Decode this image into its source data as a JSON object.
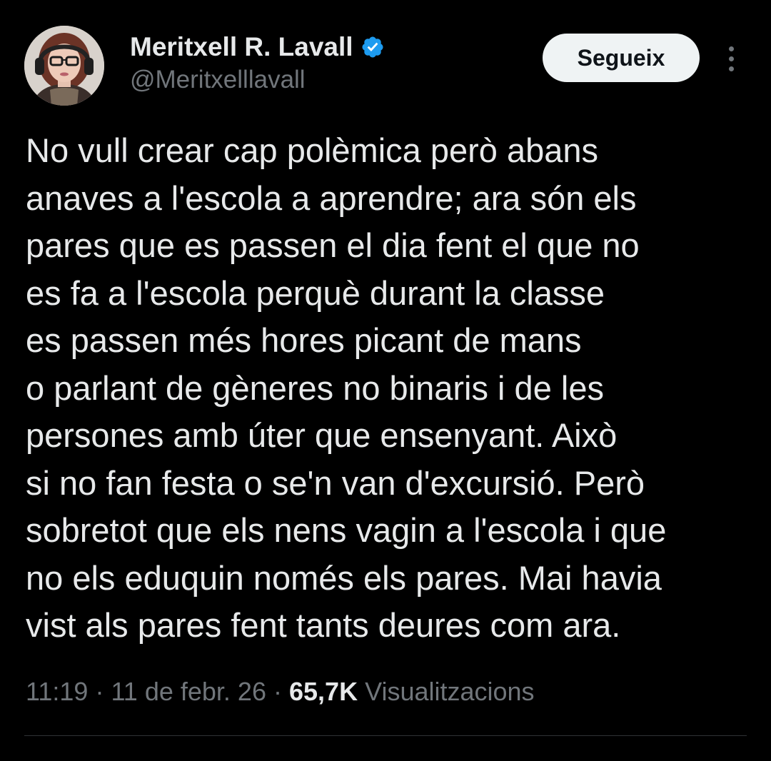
{
  "colors": {
    "background": "#000000",
    "text_primary": "#e7e9ea",
    "text_secondary": "#71767b",
    "verified_blue": "#1d9bf0",
    "follow_button_bg": "#eff3f4",
    "divider": "#2f3336"
  },
  "author": {
    "display_name": "Meritxell R. Lavall",
    "handle": "@Meritxelllavall",
    "verified": true,
    "verified_icon": "verified-badge-icon",
    "avatar_icon": "avatar-photo"
  },
  "actions": {
    "follow_label": "Segueix",
    "more_icon": "more-vertical-icon"
  },
  "tweet": {
    "lines": [
      "No vull crear cap polèmica però abans",
      "anaves a l'escola a aprendre; ara són els",
      "pares que es passen el dia fent el que no",
      "es fa a l'escola perquè durant la classe",
      "es passen més hores picant de mans",
      "o parlant de gèneres no binaris i de les",
      "persones amb úter que ensenyant. Això",
      "si no fan festa o se'n van d'excursió. Però",
      "sobretot que els nens vagin a l'escola i que",
      "no els eduquin només els pares. Mai havia",
      "vist als pares fent tants deures com ara."
    ]
  },
  "meta": {
    "time": "11:19",
    "separator": "·",
    "date": "11 de febr. 26",
    "views_count": "65,7K",
    "views_label": "Visualitzacions"
  }
}
